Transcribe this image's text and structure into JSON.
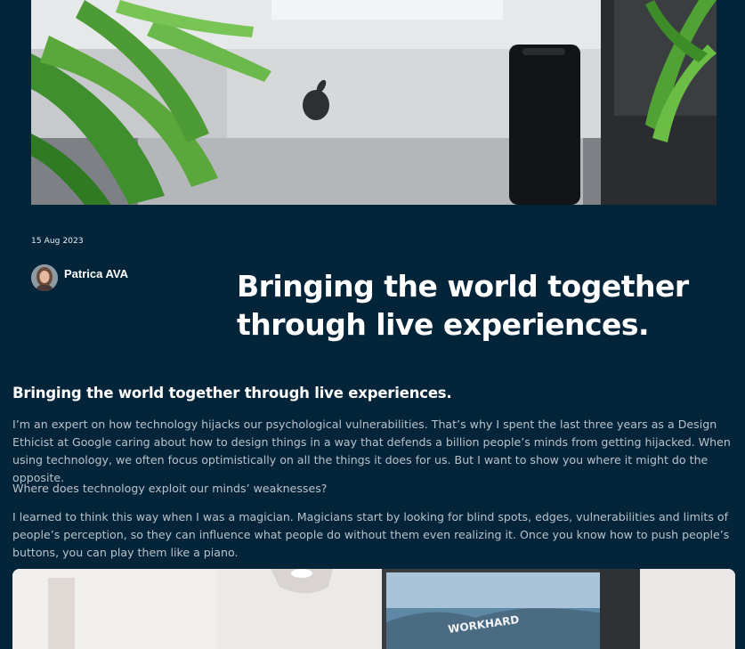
{
  "post": {
    "date": "15 Aug 2023",
    "author_name": "Patrica AVA",
    "headline": "Bringing the world together through live experiences.",
    "subheading": "Bringing the world together through live experiences.",
    "paragraphs": [
      "I’m an expert on how technology hijacks our psychological vulnerabilities. That’s why I spent the last three years as a Design Ethicist at Google caring about how to design things in a way that defends a billion people’s minds from getting hijacked. When using technology, we often focus optimistically on all the things it does for us. But I want to show you where it might do the opposite.",
      "Where does technology exploit our minds’ weaknesses?",
      "I learned to think this way when I was a magician. Magicians start by looking for blind spots, edges, vulnerabilities and limits of people’s perception, so they can influence what people do without them even realizing it. Once you know how to push people’s buttons, you can play them like a piano."
    ],
    "image2_screen_text": "WORKHARD"
  },
  "colors": {
    "background": "#04243a",
    "body_text": "#b9c2c9",
    "heading_text": "#ffffff"
  }
}
